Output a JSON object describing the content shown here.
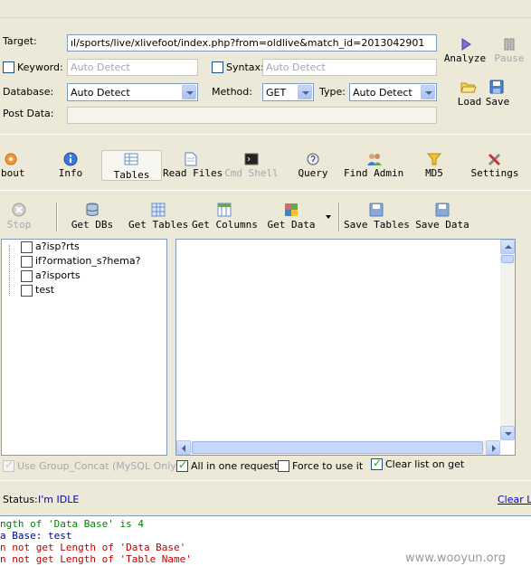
{
  "request": {
    "target_label": "Target:",
    "target_value": "ıl/sports/live/xlivefoot/index.php?from=oldlive&match_id=2013042901",
    "keyword_label": "Keyword:",
    "keyword_placeholder": "Auto Detect",
    "syntax_label": "Syntax:",
    "syntax_placeholder": "Auto Detect",
    "database_label": "Database:",
    "database_value": "Auto Detect",
    "method_label": "Method:",
    "method_value": "GET",
    "type_label": "Type:",
    "type_value": "Auto Detect",
    "postdata_label": "Post Data:",
    "analyze_label": "Analyze",
    "pause_label": "Pause",
    "load_label": "Load",
    "save_label": "Save"
  },
  "main_toolbar": [
    {
      "id": "about",
      "label": "bout",
      "icon": "about-icon"
    },
    {
      "id": "info",
      "label": "Info",
      "icon": "info-icon"
    },
    {
      "id": "tables",
      "label": "Tables",
      "icon": "tables-icon",
      "active": true
    },
    {
      "id": "readfiles",
      "label": "Read Files",
      "icon": "document-icon"
    },
    {
      "id": "cmdshell",
      "label": "Cmd Shell",
      "icon": "terminal-icon",
      "disabled": true
    },
    {
      "id": "query",
      "label": "Query",
      "icon": "query-icon"
    },
    {
      "id": "findadmin",
      "label": "Find Admin",
      "icon": "users-icon"
    },
    {
      "id": "md5",
      "label": "MD5",
      "icon": "funnel-icon"
    },
    {
      "id": "settings",
      "label": "Settings",
      "icon": "tools-icon"
    }
  ],
  "table_toolbar": [
    {
      "id": "stop",
      "label": "Stop",
      "icon": "stop-icon",
      "disabled": true
    },
    {
      "id": "getdbs",
      "label": "Get DBs",
      "icon": "database-icon"
    },
    {
      "id": "gettables",
      "label": "Get Tables",
      "icon": "grid-icon"
    },
    {
      "id": "getcolumns",
      "label": "Get Columns",
      "icon": "columns-icon"
    },
    {
      "id": "getdata",
      "label": "Get Data",
      "icon": "data-icon"
    },
    {
      "id": "savetables",
      "label": "Save Tables",
      "icon": "floppy-icon"
    },
    {
      "id": "savedata",
      "label": "Save Data",
      "icon": "floppy-icon"
    }
  ],
  "tree": [
    {
      "label": "a?isp?rts"
    },
    {
      "label": "if?ormation_s?hema?"
    },
    {
      "label": "a?isports"
    },
    {
      "label": "test"
    }
  ],
  "options": {
    "group_concat_label": "Use Group_Concat (MySQL Only)",
    "all_in_one_label": "All in one request.",
    "force_label": "Force to use it",
    "clear_list_label": "Clear list on get"
  },
  "status": {
    "label": "Status:",
    "value": "I'm IDLE",
    "clear_log": "Clear Lo"
  },
  "log": [
    {
      "text": "ngth of 'Data Base' is 4",
      "color": "#008000"
    },
    {
      "text": "a Base: test",
      "color": "#00008b"
    },
    {
      "text": "n not get Length of 'Data Base'",
      "color": "#c00000"
    },
    {
      "text": "n not get Length of 'Table Name'",
      "color": "#c00000"
    }
  ],
  "watermark": "www.wooyun.org"
}
